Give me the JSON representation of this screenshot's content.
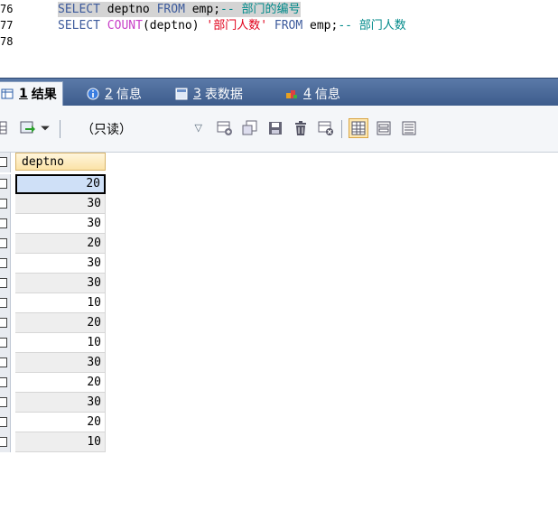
{
  "editor": {
    "lines": [
      {
        "num": "76",
        "segments": [
          {
            "t": "SELECT",
            "c": "kw"
          },
          {
            "t": " deptno ",
            "c": "ident"
          },
          {
            "t": "FROM",
            "c": "kw"
          },
          {
            "t": " emp;",
            "c": "ident"
          },
          {
            "t": "-- 部门的编号",
            "c": "cmt"
          }
        ],
        "highlight": true
      },
      {
        "num": "77",
        "segments": [
          {
            "t": "SELECT",
            "c": "kw"
          },
          {
            "t": " ",
            "c": "ident"
          },
          {
            "t": "COUNT",
            "c": "fn"
          },
          {
            "t": "(deptno) ",
            "c": "ident"
          },
          {
            "t": "'部门人数'",
            "c": "str"
          },
          {
            "t": " ",
            "c": "ident"
          },
          {
            "t": "FROM",
            "c": "kw"
          },
          {
            "t": " emp;",
            "c": "ident"
          },
          {
            "t": "-- 部门人数",
            "c": "cmt"
          }
        ],
        "highlight": false
      },
      {
        "num": "78",
        "segments": [],
        "highlight": false
      }
    ]
  },
  "tabs": [
    {
      "num": "1",
      "label": "结果",
      "icon": "result-grid-icon",
      "active": true
    },
    {
      "num": "2",
      "label": "信息",
      "icon": "info-icon",
      "active": false
    },
    {
      "num": "3",
      "label": "表数据",
      "icon": "table-data-icon",
      "active": false
    },
    {
      "num": "4",
      "label": "信息",
      "icon": "info-colored-icon",
      "active": false
    }
  ],
  "toolbar": {
    "readonly_label": "（只读）",
    "icons": [
      "grid-view-icon",
      "export-icon",
      "add-row-icon",
      "duplicate-row-icon",
      "save-icon",
      "delete-icon",
      "cancel-icon",
      "grid-mode-icon",
      "form-mode-icon",
      "text-mode-icon"
    ]
  },
  "grid": {
    "column": "deptno",
    "rows": [
      "20",
      "30",
      "30",
      "20",
      "30",
      "30",
      "10",
      "20",
      "10",
      "30",
      "20",
      "30",
      "20",
      "10"
    ],
    "selected_index": 0
  },
  "colors": {
    "tab_bar": "#4a6a9a",
    "selected_cell": "#cfe0f7",
    "header_cell": "#fbe2a6"
  }
}
